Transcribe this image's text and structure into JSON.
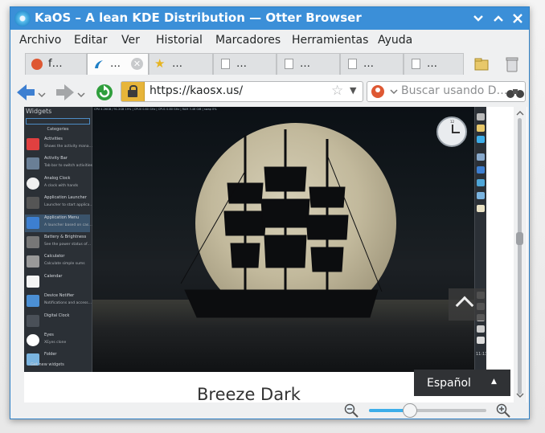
{
  "window": {
    "title": "KaOS – A lean KDE Distribution — Otter Browser",
    "controls": [
      "chevron-down-icon",
      "chevron-up-icon",
      "close-icon"
    ]
  },
  "menu": [
    "Archivo",
    "Editar",
    "Ver",
    "Historial",
    "Marcadores",
    "Herramientas",
    "Ayuda"
  ],
  "tabs": [
    {
      "label": "f…",
      "icon": "duckduckgo-icon",
      "active": false
    },
    {
      "label": "…",
      "icon": "kaos-icon",
      "active": true
    },
    {
      "label": "…",
      "icon": "star-icon",
      "active": false
    },
    {
      "label": "…",
      "icon": "page-icon",
      "active": false
    },
    {
      "label": "…",
      "icon": "page-icon",
      "active": false
    },
    {
      "label": "…",
      "icon": "page-icon",
      "active": false
    },
    {
      "label": "…",
      "icon": "page-icon",
      "active": false
    }
  ],
  "address": {
    "url": "https://kaosx.us/"
  },
  "search": {
    "placeholder": "Buscar usando D…"
  },
  "desktop": {
    "widgets_title": "Widgets",
    "categories": "Categories",
    "items": [
      {
        "name": "Activities",
        "desc": "Shows the activity mana…"
      },
      {
        "name": "Activity Bar",
        "desc": "Tab bar to switch activities"
      },
      {
        "name": "Analog Clock",
        "desc": "A clock with hands"
      },
      {
        "name": "Application Launcher",
        "desc": "Launcher to start applica…"
      },
      {
        "name": "Application Menu",
        "desc": "A launcher based on cas…"
      },
      {
        "name": "Battery & Brightness",
        "desc": "See the power status of…"
      },
      {
        "name": "Calculator",
        "desc": "Calculate simple sums"
      },
      {
        "name": "Calendar",
        "desc": ""
      },
      {
        "name": "Device Notifier",
        "desc": "Notifications and access…"
      },
      {
        "name": "Digital Clock",
        "desc": ""
      },
      {
        "name": "Eyes",
        "desc": "XEyes clone"
      },
      {
        "name": "Folder",
        "desc": ""
      }
    ],
    "get_new": "Get new widgets",
    "panel_time": "11:13"
  },
  "page": {
    "heading": "Breeze Dark"
  },
  "language": {
    "label": "Español"
  },
  "zoom": {
    "level_fraction": 0.35
  },
  "colors": {
    "titlebar": "#3b8fd8",
    "accent": "#3daee9",
    "lock": "#e7b53a"
  }
}
